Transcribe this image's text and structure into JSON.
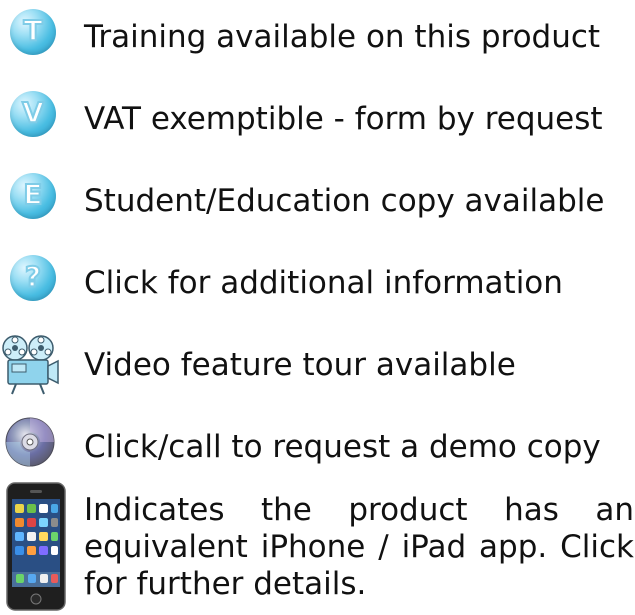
{
  "legend": {
    "items": [
      {
        "icon": "training-icon",
        "letter": "T",
        "label": "Training available on this product"
      },
      {
        "icon": "vat-icon",
        "letter": "V",
        "label": "VAT exemptible - form by request"
      },
      {
        "icon": "education-icon",
        "letter": "E",
        "label": "Student/Education copy available"
      },
      {
        "icon": "info-icon",
        "letter": "?",
        "label": "Click for additional information"
      },
      {
        "icon": "video-projector-icon",
        "label": "Video feature tour available"
      },
      {
        "icon": "cd-icon",
        "label": "Click/call to request a demo copy"
      }
    ],
    "phone": {
      "icon": "iphone-icon",
      "label": "Indicates the product has an equivalent iPhone / iPad app. Click for further details."
    }
  },
  "colors": {
    "badge_light": "#9fe0f5",
    "badge_dark": "#2795c2",
    "text": "#111111"
  }
}
